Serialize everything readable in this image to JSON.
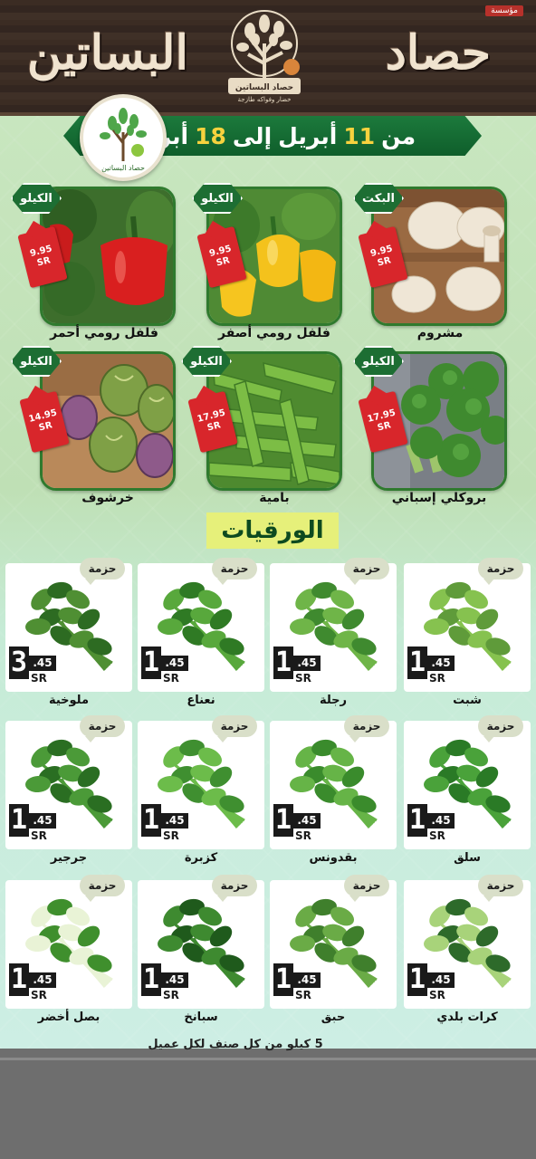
{
  "header": {
    "corner_tag": "مؤسسة",
    "brand_first": "حصاد",
    "brand_second": "البساتين",
    "logo_caption": "حصاد البساتين",
    "logo_subcaption": "خضار وفواكه طازجة"
  },
  "promo": {
    "from_label": "من",
    "start_day": "11",
    "month": "أبريل",
    "to_label": "إلى",
    "end_day": "18",
    "circle_logo_caption": "حصاد البساتين"
  },
  "currency": "SR",
  "featured_products": [
    {
      "name": "مشروم",
      "unit": "البكت",
      "price": "9.95",
      "image": "mushroom"
    },
    {
      "name": "فلفل رومي أصفر",
      "unit": "الكيلو",
      "price": "9.95",
      "image": "yellow-pepper"
    },
    {
      "name": "فلفل رومي أحمر",
      "unit": "الكيلو",
      "price": "9.95",
      "image": "red-pepper"
    },
    {
      "name": "بروكلي إسباني",
      "unit": "الكيلو",
      "price": "17.95",
      "image": "broccoli"
    },
    {
      "name": "بامية",
      "unit": "الكيلو",
      "price": "17.95",
      "image": "okra"
    },
    {
      "name": "خرشوف",
      "unit": "الكيلو",
      "price": "14.95",
      "image": "artichoke"
    }
  ],
  "section_title": "الورقيات",
  "leafy_unit": "حزمة",
  "leafy_products": [
    {
      "name": "شبت",
      "price_int": "1",
      "price_dec": ".45",
      "image": "dill"
    },
    {
      "name": "رجلة",
      "price_int": "1",
      "price_dec": ".45",
      "image": "purslane"
    },
    {
      "name": "نعناع",
      "price_int": "1",
      "price_dec": ".45",
      "image": "mint"
    },
    {
      "name": "ملوخية",
      "price_int": "3",
      "price_dec": ".45",
      "image": "molokhia"
    },
    {
      "name": "سلق",
      "price_int": "1",
      "price_dec": ".45",
      "image": "chard"
    },
    {
      "name": "بقدونس",
      "price_int": "1",
      "price_dec": ".45",
      "image": "parsley"
    },
    {
      "name": "كزبرة",
      "price_int": "1",
      "price_dec": ".45",
      "image": "coriander"
    },
    {
      "name": "جرجير",
      "price_int": "1",
      "price_dec": ".45",
      "image": "arugula"
    },
    {
      "name": "كرات بلدي",
      "price_int": "1",
      "price_dec": ".45",
      "image": "leek"
    },
    {
      "name": "حبق",
      "price_int": "1",
      "price_dec": ".45",
      "image": "basil"
    },
    {
      "name": "سبانخ",
      "price_int": "1",
      "price_dec": ".45",
      "image": "spinach"
    },
    {
      "name": "بصل أخضر",
      "price_int": "1",
      "price_dec": ".45",
      "image": "green-onion"
    }
  ],
  "footer_note": "5 كيلو من كل صنف لكل عميل",
  "colors": {
    "header_wood": "#3b2c23",
    "ribbon_green": "#1c7a3c",
    "price_red": "#d8262b",
    "badge_green": "#1d6e33",
    "section_yellow": "#e6f07a"
  }
}
